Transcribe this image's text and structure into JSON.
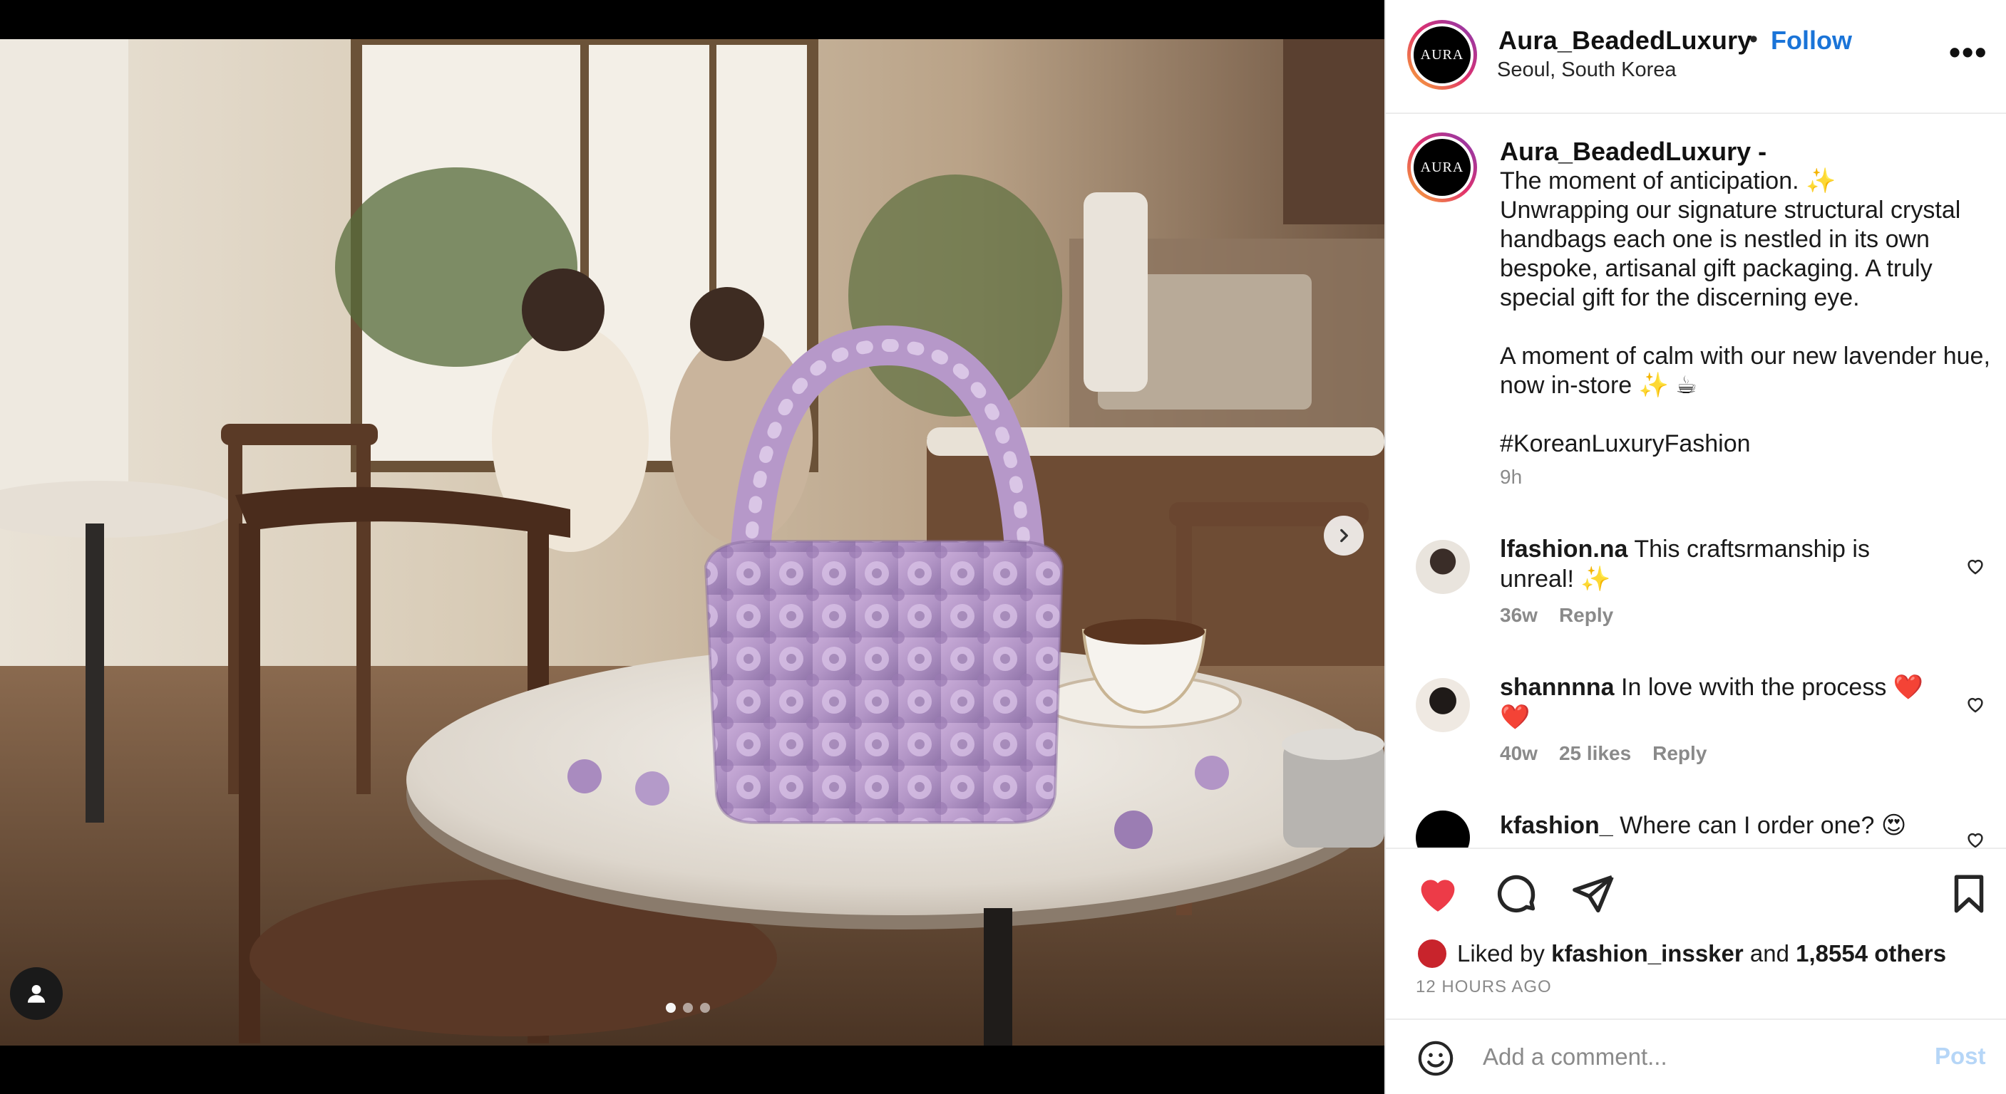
{
  "post": {
    "username": "Aura_BeadedLuxury",
    "separator": "•",
    "follow_label": "Follow",
    "location": "Seoul, South Korea",
    "more_label": "•••",
    "avatar_text": "AURA"
  },
  "caption": {
    "username": "Aura_BeadedLuxury -",
    "text": "The moment of anticipation. ✨\nUnwrapping our signature structural crystal handbags  each one is nestled in its own bespoke, artisanal gift packaging. A truly special gift for the discerning eye.\n\nA moment of calm with our new lavender hue, now in-store ✨ ☕\n\n#KoreanLuxuryFashion",
    "time": "9h"
  },
  "comments": [
    {
      "username": "lfashion.na",
      "text": "This craftsrmanship is unreal! ✨",
      "time": "36w",
      "likes": "",
      "reply_label": "Reply"
    },
    {
      "username": "shannnna",
      "text": "In love wvith the process ❤️ ❤️",
      "time": "40w",
      "likes": "25 likes",
      "reply_label": "Reply"
    },
    {
      "username": "kfashion_",
      "text": "Where can I order one? 😍",
      "time": "",
      "likes": "",
      "reply_label": ""
    }
  ],
  "likes": {
    "prefix": "Liked by ",
    "user": "kfashion_inssker",
    "middle": " and ",
    "count": "1,8554 others"
  },
  "timestamp": "12 HOURS AGO",
  "add_comment": {
    "placeholder": "Add a comment...",
    "post_label": "Post"
  },
  "carousel": {
    "total": 3,
    "active": 1
  },
  "colors": {
    "accent": "#1a74d8",
    "like_red": "#ed3b48",
    "post_disabled": "#b6d6f7"
  },
  "icons": [
    "chevron-right-icon",
    "person-icon",
    "more-icon",
    "heart-icon",
    "comment-icon",
    "share-icon",
    "bookmark-icon",
    "smiley-icon"
  ]
}
